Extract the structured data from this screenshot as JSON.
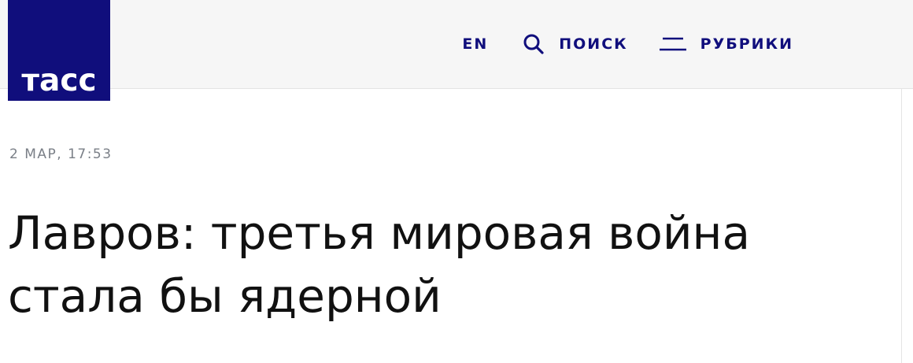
{
  "header": {
    "logo_text": "тасс",
    "brand_color": "#100e7c",
    "nav": {
      "lang_label": "EN",
      "search_label": "ПОИСК",
      "rubrics_label": "РУБРИКИ"
    },
    "icons": {
      "search": "search-icon",
      "menu": "menu-icon"
    }
  },
  "article": {
    "date": "2 МАР, 17:53",
    "title": "Лавров: третья мировая война стала бы ядерной"
  }
}
